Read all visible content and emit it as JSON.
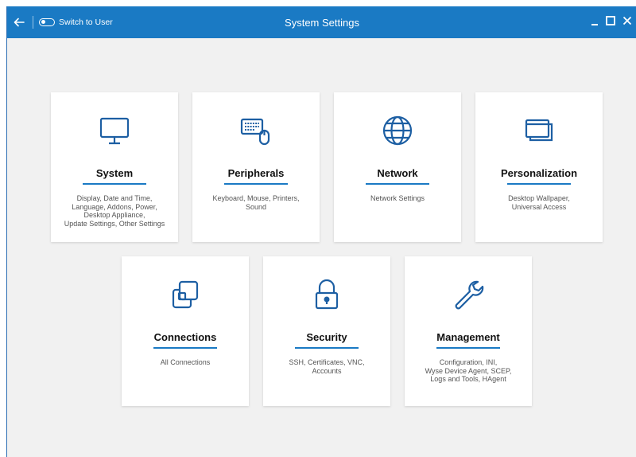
{
  "titlebar": {
    "switch_label": "Switch to User",
    "title": "System Settings"
  },
  "accent_color": "#1a7ac4",
  "cards": [
    {
      "title": "System",
      "desc": "Display, Date and Time,\nLanguage, Addons, Power,\nDesktop Appliance,\nUpdate Settings, Other Settings",
      "icon": "monitor-icon"
    },
    {
      "title": "Peripherals",
      "desc": "Keyboard, Mouse, Printers,\nSound",
      "icon": "keyboard-mouse-icon"
    },
    {
      "title": "Network",
      "desc": "Network Settings",
      "icon": "globe-icon"
    },
    {
      "title": "Personalization",
      "desc": "Desktop Wallpaper,\nUniversal Access",
      "icon": "windows-icon"
    },
    {
      "title": "Connections",
      "desc": "All Connections",
      "icon": "connections-icon"
    },
    {
      "title": "Security",
      "desc": "SSH, Certificates, VNC,\nAccounts",
      "icon": "lock-icon"
    },
    {
      "title": "Management",
      "desc": "Configuration, INI,\nWyse Device Agent, SCEP,\nLogs and Tools, HAgent",
      "icon": "wrench-icon"
    }
  ]
}
